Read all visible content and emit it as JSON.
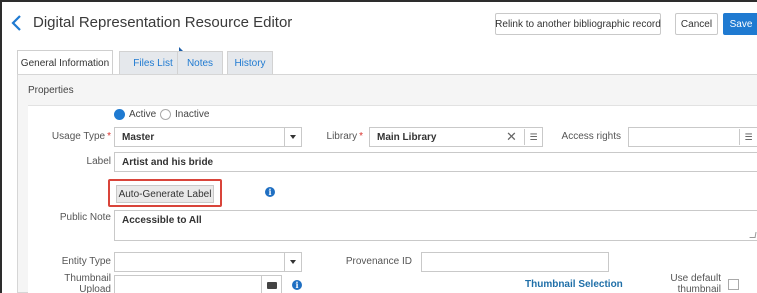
{
  "header": {
    "title": "Digital Representation Resource Editor",
    "relink_label": "Relink to another bibliographic record",
    "cancel_label": "Cancel",
    "save_label": "Save"
  },
  "tabs": [
    {
      "label": "General Information",
      "active": true
    },
    {
      "label": "Files List",
      "active": false
    },
    {
      "label": "Notes",
      "active": false
    },
    {
      "label": "History",
      "active": false
    }
  ],
  "properties": {
    "section_title": "Properties",
    "status": {
      "active_label": "Active",
      "inactive_label": "Inactive",
      "selected": "Active"
    },
    "usage_type": {
      "label": "Usage Type",
      "value": "Master"
    },
    "library": {
      "label": "Library",
      "value": "Main Library"
    },
    "access_rights": {
      "label": "Access rights",
      "value": ""
    },
    "label_field": {
      "label": "Label",
      "value": "Artist and his bride"
    },
    "auto_generate_label": "Auto-Generate Label",
    "public_note": {
      "label": "Public Note",
      "value": "Accessible to All"
    },
    "entity_type": {
      "label": "Entity Type",
      "value": ""
    },
    "provenance_id": {
      "label": "Provenance ID",
      "value": ""
    },
    "thumbnail_upload": {
      "label_line1": "Thumbnail",
      "label_line2": "Upload",
      "value": ""
    },
    "thumbnail_selection": "Thumbnail Selection",
    "use_default_thumbnail": {
      "label_line1": "Use default",
      "label_line2": "thumbnail",
      "checked": false
    }
  },
  "colors": {
    "accent": "#1f7ad1",
    "highlight_border": "#d9443a",
    "required_star": "#d9322d"
  }
}
